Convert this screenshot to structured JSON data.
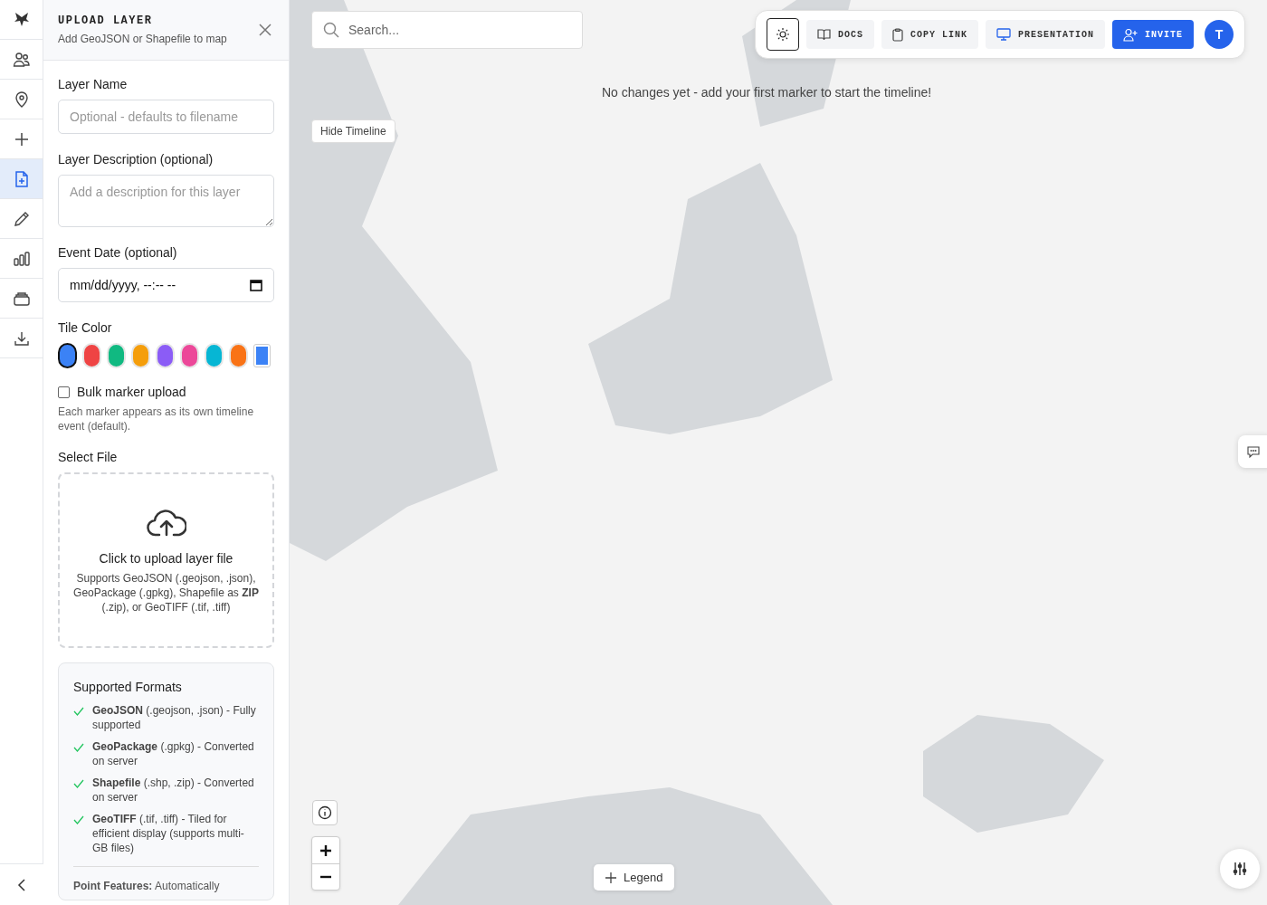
{
  "sidebar": {
    "items": [
      {
        "kind": "logo",
        "selected": false
      },
      {
        "kind": "people",
        "selected": false
      },
      {
        "kind": "pin",
        "selected": false
      },
      {
        "kind": "plus",
        "selected": false
      },
      {
        "kind": "file",
        "selected": true
      },
      {
        "kind": "pencil",
        "selected": false
      },
      {
        "kind": "chart",
        "selected": false
      },
      {
        "kind": "layers",
        "selected": false
      },
      {
        "kind": "download",
        "selected": false
      }
    ]
  },
  "panel": {
    "title": "UPLOAD LAYER",
    "subtitle": "Add GeoJSON or Shapefile to map",
    "layer_name": {
      "label": "Layer Name",
      "placeholder": "Optional - defaults to filename"
    },
    "description": {
      "label": "Layer Description (optional)",
      "placeholder": "Add a description for this layer"
    },
    "event_date": {
      "label": "Event Date (optional)",
      "value": "mm/dd/yyyy, --:-- --"
    },
    "tile_color": {
      "label": "Tile Color",
      "swatches": [
        {
          "kind": "swatch",
          "color": "#3b82f6",
          "selected": true
        },
        {
          "kind": "swatch",
          "color": "#ef4444",
          "selected": false
        },
        {
          "kind": "swatch",
          "color": "#10b981",
          "selected": false
        },
        {
          "kind": "swatch",
          "color": "#f59e0b",
          "selected": false
        },
        {
          "kind": "swatch",
          "color": "#8b5cf6",
          "selected": false
        },
        {
          "kind": "swatch",
          "color": "#ec4899",
          "selected": false
        },
        {
          "kind": "swatch",
          "color": "#06b6d4",
          "selected": false
        },
        {
          "kind": "swatch",
          "color": "#f97316",
          "selected": false
        },
        {
          "kind": "picker",
          "color": "#3b82f6",
          "selected": false
        }
      ]
    },
    "bulk": {
      "label": "Bulk marker upload",
      "checked": false,
      "hint": "Each marker appears as its own timeline event (default)."
    },
    "select_file": {
      "label": "Select File",
      "title": "Click to upload layer file",
      "text": "Supports GeoJSON (.geojson, .json), GeoPackage (.gpkg), Shapefile as **ZIP** (.zip), or GeoTIFF (.tif, .tiff)"
    },
    "formats": {
      "title": "Supported Formats",
      "items": [
        "**GeoJSON** (.geojson, .json) - Fully supported",
        "**GeoPackage** (.gpkg) - Converted on server",
        "**Shapefile** (.shp, .zip) - Converted on server",
        "**GeoTIFF** (.tif, .tiff) - Tiled for efficient display (supports multi-GB files)"
      ],
      "note": "**Point Features:** Automatically"
    }
  },
  "map": {
    "search": {
      "placeholder": "Search..."
    },
    "toolbar": [
      {
        "kind": "theme"
      },
      {
        "kind": "docs",
        "label": "DOCS"
      },
      {
        "kind": "link",
        "label": "COPY LINK"
      },
      {
        "kind": "presentation",
        "label": "PRESENTATION"
      },
      {
        "kind": "invite",
        "label": "INVITE"
      }
    ],
    "avatar": "T",
    "timeline_message": "No changes yet - add your first marker to start the timeline!",
    "hide_timeline": "Hide Timeline",
    "legend": "Legend"
  }
}
